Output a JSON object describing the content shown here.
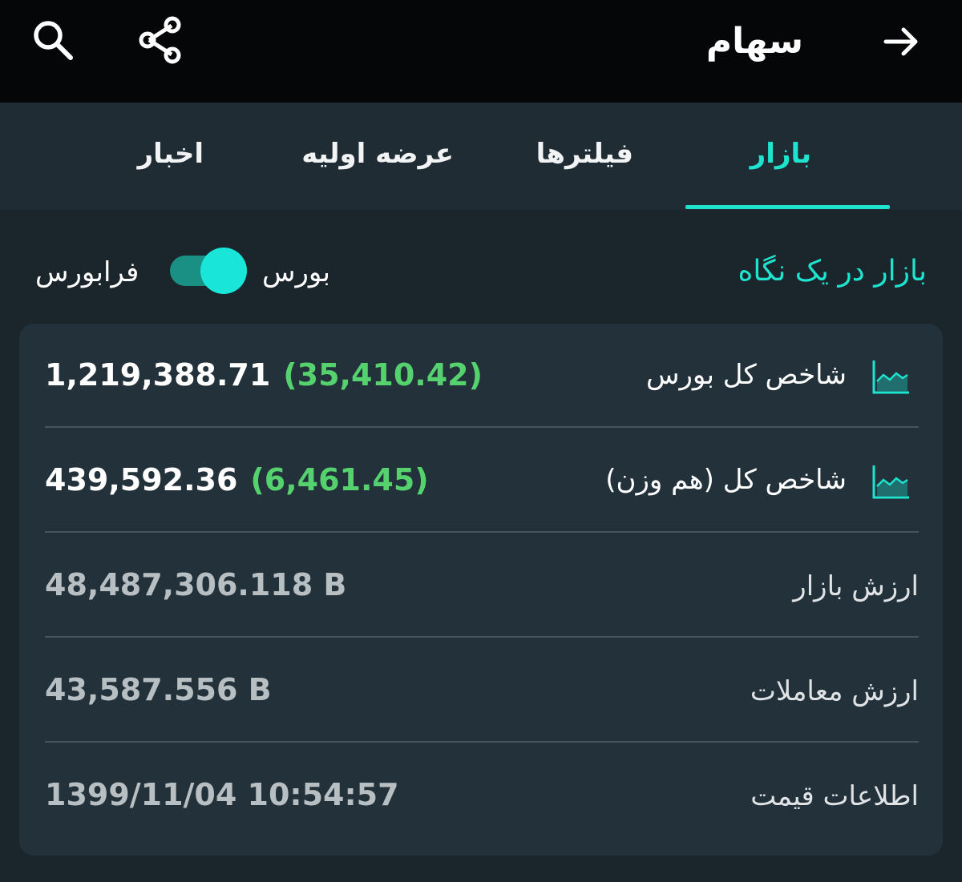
{
  "header": {
    "title": "سهام",
    "back_icon": "arrow-right-icon",
    "share_icon": "share-icon",
    "search_icon": "search-icon"
  },
  "tabs": [
    {
      "label": "بازار",
      "active": true
    },
    {
      "label": "فیلترها",
      "active": false
    },
    {
      "label": "عرضه اولیه",
      "active": false
    },
    {
      "label": "اخبار",
      "active": false
    }
  ],
  "market_overview": {
    "title": "بازار در یک نگاه",
    "toggle": {
      "left_label": "فرابورس",
      "right_label": "بورس",
      "selected": "بورس"
    }
  },
  "indices": [
    {
      "label": "شاخص کل بورس",
      "value": "1,219,388.71",
      "change": "(35,410.42)",
      "icon": "line-chart-icon"
    },
    {
      "label": "شاخص کل (هم وزن)",
      "value": "439,592.36",
      "change": "(6,461.45)",
      "icon": "line-chart-icon"
    }
  ],
  "stats": [
    {
      "label": "ارزش بازار",
      "value": "48,487,306.118 B"
    },
    {
      "label": "ارزش معاملات",
      "value": "43,587.556 B"
    },
    {
      "label": "اطلاعات قیمت",
      "value": "1399/11/04 10:54:57"
    }
  ],
  "colors": {
    "accent": "#1ee3cf",
    "positive_change": "#55d26d",
    "background": "#1b262c",
    "card": "#22313a",
    "topbar": "#050608"
  }
}
